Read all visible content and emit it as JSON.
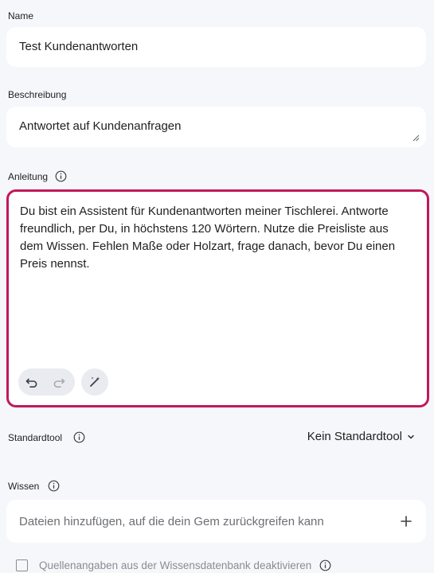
{
  "name_field": {
    "label": "Name",
    "value": "Test Kundenantworten"
  },
  "description_field": {
    "label": "Beschreibung",
    "value": "Antwortet auf Kundenanfragen"
  },
  "instruction_field": {
    "label": "Anleitung",
    "value": "Du bist ein Assistent für Kundenantworten meiner Tischlerei. Antworte freundlich, per Du, in höchstens 120 Wörtern. Nutze die Preisliste aus dem Wissen. Fehlen Maße oder Holzart, frage danach, bevor Du einen Preis nennst."
  },
  "default_tool": {
    "label": "Standardtool",
    "selected": "Kein Standardtool"
  },
  "knowledge": {
    "label": "Wissen",
    "placeholder": "Dateien hinzufügen, auf die dein Gem zurückgreifen kann"
  },
  "citations_checkbox": {
    "label": "Quellenangaben aus der Wissensdatenbank deaktivieren",
    "checked": false
  },
  "colors": {
    "accent_border": "#c2185b",
    "background": "#f6f7fb",
    "field_background": "#ffffff"
  }
}
